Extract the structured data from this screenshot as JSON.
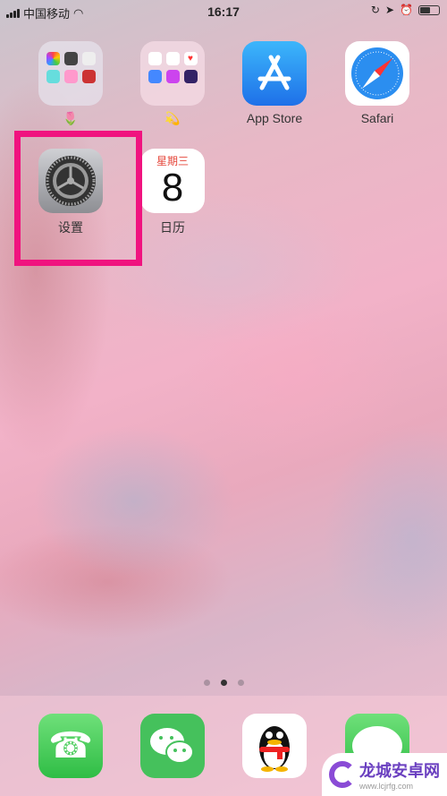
{
  "status_bar": {
    "carrier": "中国移动",
    "time": "16:17",
    "icons": [
      "signal-icon",
      "wifi-icon",
      "orientation-lock-icon",
      "location-icon",
      "alarm-icon",
      "battery-icon"
    ],
    "battery_percent": 55
  },
  "apps": [
    {
      "label": "🌷",
      "type": "folder"
    },
    {
      "label": "💫",
      "type": "folder"
    },
    {
      "label": "App Store",
      "icon": "app-store-icon"
    },
    {
      "label": "Safari",
      "icon": "safari-icon"
    },
    {
      "label": "设置",
      "icon": "settings-gear-icon"
    },
    {
      "label": "日历",
      "icon": "calendar-icon",
      "weekday": "星期三",
      "day": "8"
    }
  ],
  "highlight_color": "#f0137f",
  "page_dots": {
    "count": 3,
    "active": 2
  },
  "dock": [
    {
      "icon": "phone-icon"
    },
    {
      "icon": "wechat-icon"
    },
    {
      "icon": "qq-icon"
    },
    {
      "icon": "messages-icon"
    }
  ],
  "watermark": {
    "name": "龙城安卓网",
    "url": "www.lcjrfg.com"
  }
}
